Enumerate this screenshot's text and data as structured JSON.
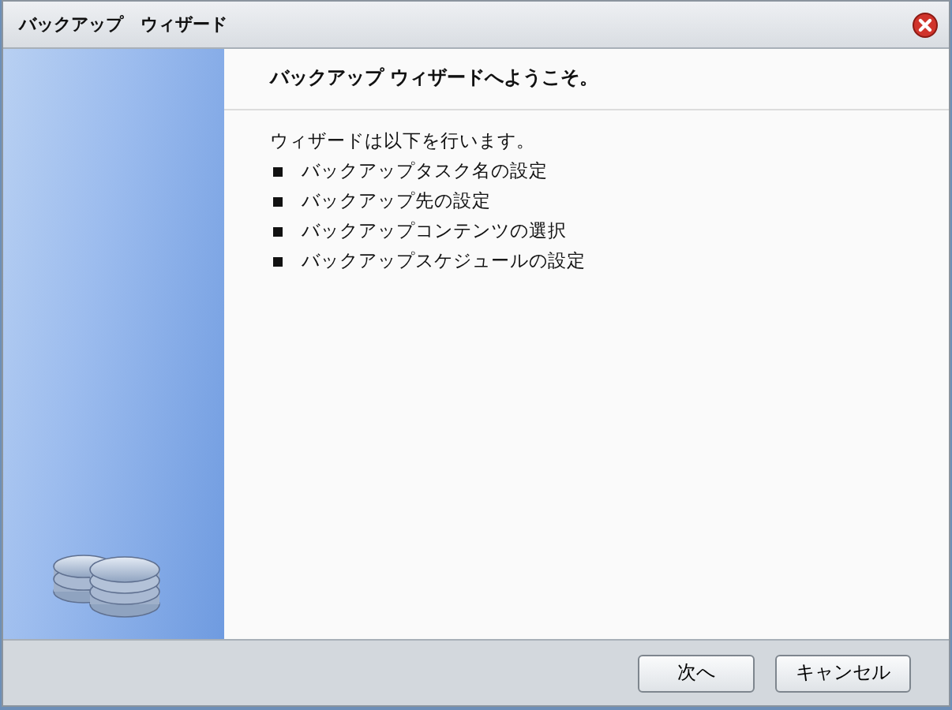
{
  "window": {
    "title": "バックアップ　ウィザード"
  },
  "heading": "バックアップ ウィザードへようこそ。",
  "intro": "ウィザードは以下を行います。",
  "steps": [
    "バックアップタスク名の設定",
    "バックアップ先の設定",
    "バックアップコンテンツの選択",
    "バックアップスケジュールの設定"
  ],
  "buttons": [
    "次へ",
    "キャンセル"
  ]
}
